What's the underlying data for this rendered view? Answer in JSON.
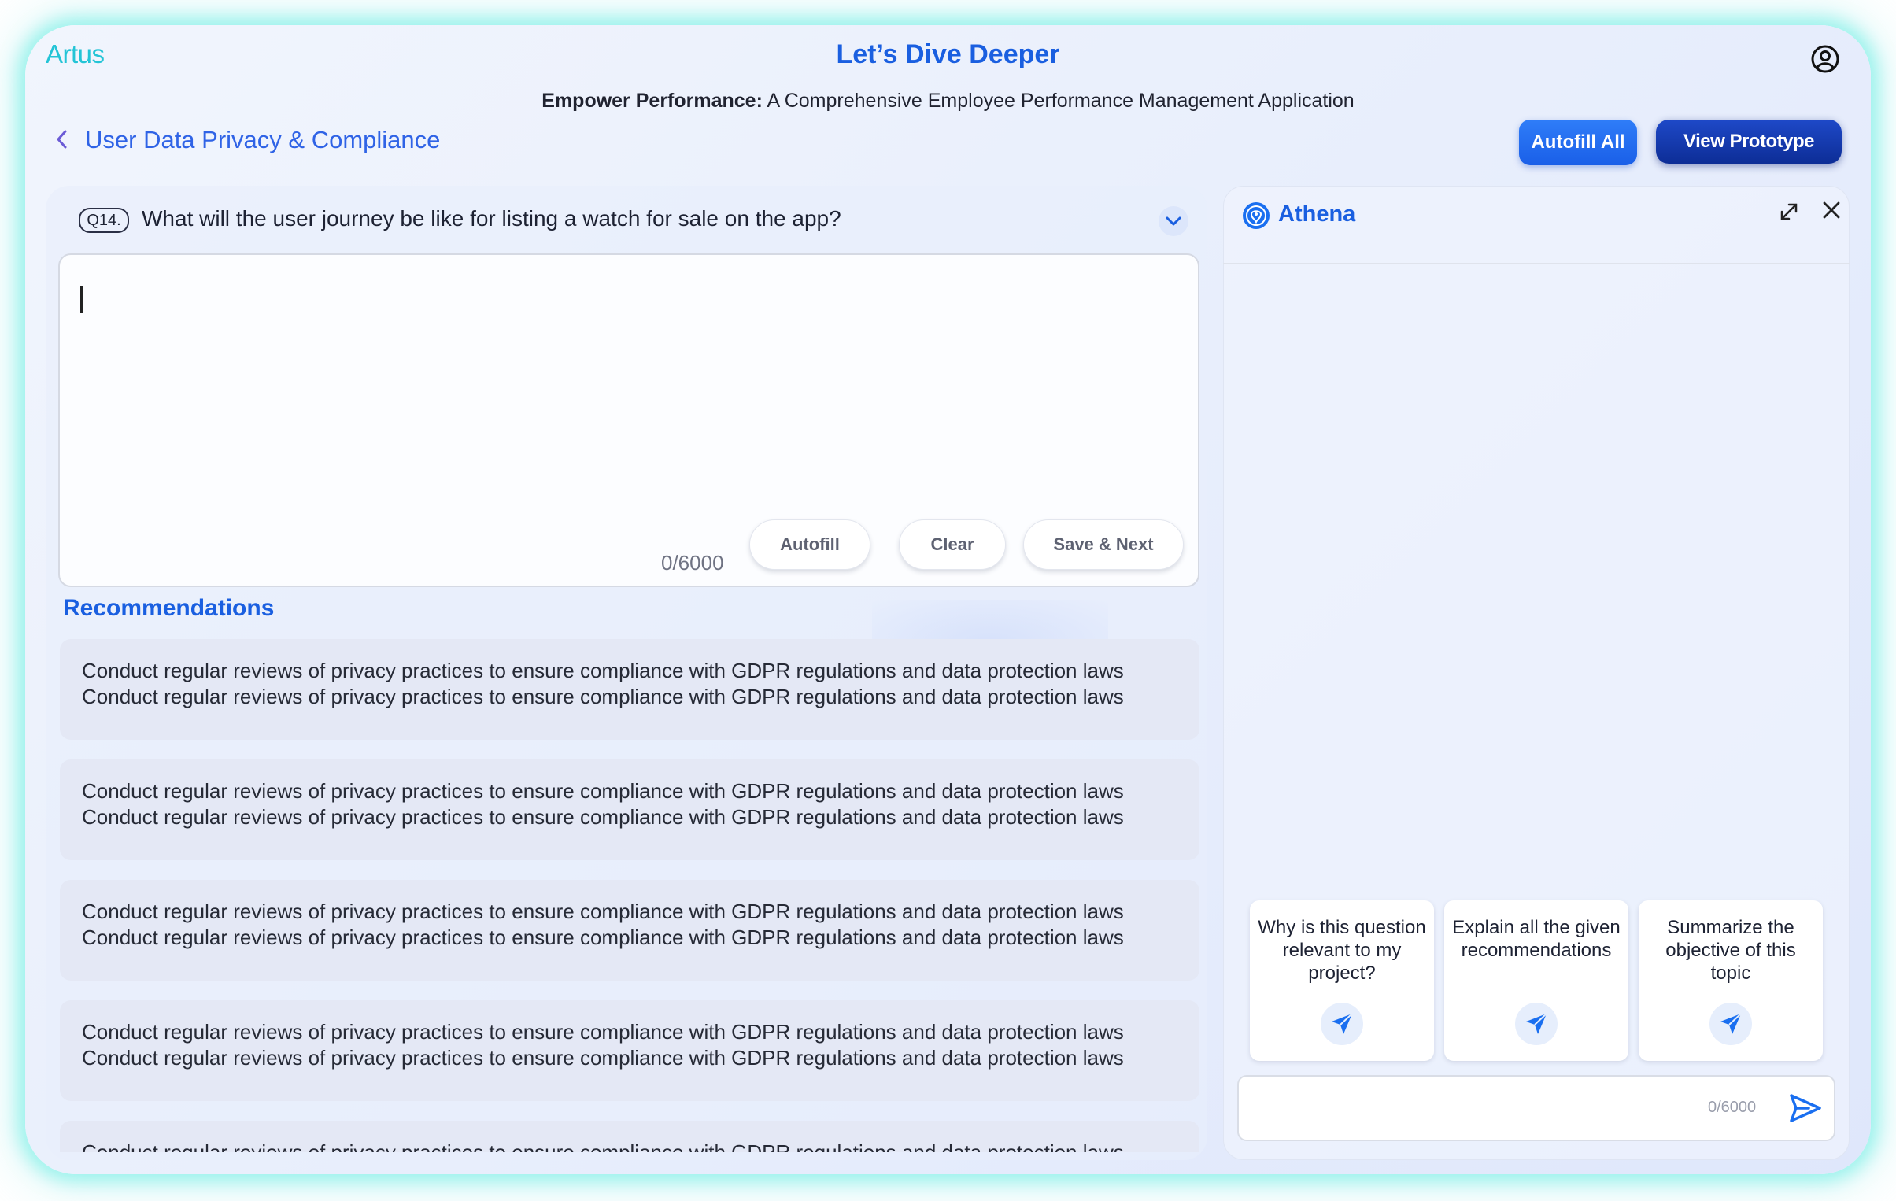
{
  "header": {
    "brand": "Artus",
    "title": "Let’s Dive Deeper",
    "subtitle_bold": "Empower Performance:",
    "subtitle_rest": " A Comprehensive Employee Performance Management Application"
  },
  "breadcrumb": {
    "label": "User Data Privacy & Compliance"
  },
  "actions": {
    "autofill_all": "Autofill All",
    "view_prototype": "View Prototype"
  },
  "question": {
    "number": "Q14.",
    "text": "What will the user journey be like for listing a watch for sale on the app?",
    "answer_value": "",
    "char_count": "0/6000",
    "autofill": "Autofill",
    "clear": "Clear",
    "save_next": "Save & Next"
  },
  "recommendations": {
    "title": "Recommendations",
    "items": [
      {
        "line1": "Conduct regular reviews of privacy practices to ensure compliance with GDPR regulations and data protection laws",
        "line2": "Conduct regular reviews of privacy practices to ensure compliance with GDPR regulations and data protection laws"
      },
      {
        "line1": "Conduct regular reviews of privacy practices to ensure compliance with GDPR regulations and data protection laws",
        "line2": "Conduct regular reviews of privacy practices to ensure compliance with GDPR regulations and data protection laws"
      },
      {
        "line1": "Conduct regular reviews of privacy practices to ensure compliance with GDPR regulations and data protection laws",
        "line2": "Conduct regular reviews of privacy practices to ensure compliance with GDPR regulations and data protection laws"
      },
      {
        "line1": "Conduct regular reviews of privacy practices to ensure compliance with GDPR regulations and data protection laws",
        "line2": "Conduct regular reviews of privacy practices to ensure compliance with GDPR regulations and data protection laws"
      },
      {
        "line1": "Conduct regular reviews of privacy practices to ensure compliance with GDPR regulations and data protection laws",
        "line2": ""
      }
    ]
  },
  "athena": {
    "name": "Athena",
    "suggestions": [
      {
        "label": "Why is this question relevant to my project?"
      },
      {
        "label": "Explain all the given recommendations"
      },
      {
        "label": "Summarize the objective of this topic"
      }
    ],
    "input_value": "",
    "char_count": "0/6000"
  },
  "icons": {
    "profile": "user-circle-icon",
    "back": "chevron-left-icon",
    "toggle": "chevron-down-icon",
    "athena_logo": "athena-logo-icon",
    "expand": "expand-icon",
    "close": "close-icon",
    "suggest_send": "send-icon",
    "chat_send": "send-outline-icon"
  },
  "colors": {
    "accent": "#1a5fe0",
    "brand": "#23c4d6",
    "primary_button": "#1a5fe8",
    "dark_button": "#0d2d96",
    "glow": "#5cece0"
  }
}
